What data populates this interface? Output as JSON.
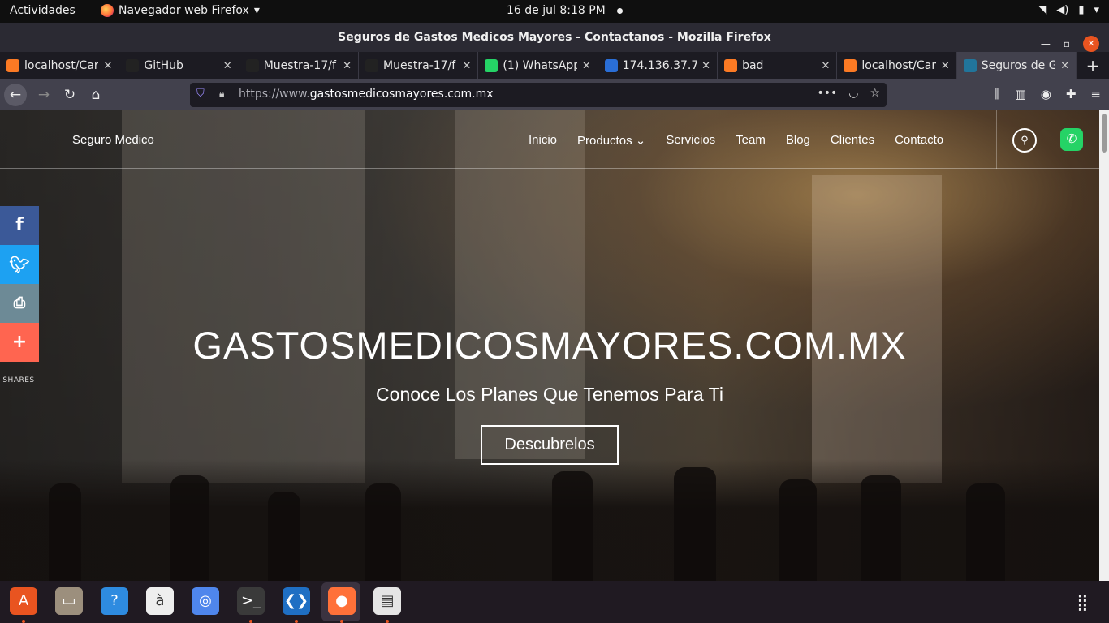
{
  "topbar": {
    "activities": "Actividades",
    "app_name": "Navegador web Firefox",
    "clock": "16 de jul   8:18 PM"
  },
  "window": {
    "title": "Seguros de Gastos Medicos Mayores - Contactanos - Mozilla Firefox"
  },
  "tabs": [
    {
      "label": "localhost/Car",
      "favicon": "xampp-icon",
      "color": "#fb7a24"
    },
    {
      "label": "GitHub",
      "favicon": "github-icon",
      "color": "#222222"
    },
    {
      "label": "Muestra-17/f",
      "favicon": "github-icon",
      "color": "#222222"
    },
    {
      "label": "Muestra-17/f",
      "favicon": "github-icon",
      "color": "#222222"
    },
    {
      "label": "(1) WhatsApp",
      "favicon": "whatsapp-icon",
      "color": "#25d366"
    },
    {
      "label": "174.136.37.7",
      "favicon": "globe-icon",
      "color": "#2a6ed6"
    },
    {
      "label": "bad",
      "favicon": "xampp-icon",
      "color": "#fb7a24"
    },
    {
      "label": "localhost/Car",
      "favicon": "xampp-icon",
      "color": "#fb7a24"
    },
    {
      "label": "Seguros de G",
      "favicon": "wordpress-icon",
      "color": "#21759b",
      "active": true
    }
  ],
  "urlbar": {
    "scheme": "https://www.",
    "host": "gastosmedicosmayores.com.mx"
  },
  "site": {
    "brand": "Seguro Medico",
    "menu": [
      "Inicio",
      "Productos ⌄",
      "Servicios",
      "Team",
      "Blog",
      "Clientes",
      "Contacto"
    ],
    "hero_title": "GASTOSMEDICOSMAYORES.COM.MX",
    "hero_subtitle": "Conoce Los Planes Que Tenemos Para Ti",
    "cta": "Descubrelos",
    "shares_label": "SHARES",
    "share_colors": {
      "facebook": "#3b5998",
      "twitter": "#1da1f2",
      "print": "#6d8a96",
      "more": "#ff6550"
    }
  },
  "dock": [
    {
      "name": "ubuntu-software-icon",
      "glyph": "A",
      "color": "#e95420",
      "running": true
    },
    {
      "name": "files-icon",
      "glyph": "▭",
      "color": "#9c8f7d",
      "running": false
    },
    {
      "name": "help-icon",
      "glyph": "?",
      "color": "#2e8be0",
      "running": false
    },
    {
      "name": "text-editor-icon",
      "glyph": "à",
      "color": "#eeeeee",
      "running": false
    },
    {
      "name": "chromium-icon",
      "glyph": "◎",
      "color": "#4f86ec",
      "running": false
    },
    {
      "name": "terminal-icon",
      "glyph": ">_",
      "color": "#3a3a3a",
      "running": true
    },
    {
      "name": "vscode-icon",
      "glyph": "❮❯",
      "color": "#1f6fc3",
      "running": true
    },
    {
      "name": "firefox-icon",
      "glyph": "●",
      "color": "#ff7139",
      "running": true
    },
    {
      "name": "screenshot-icon",
      "glyph": "▤",
      "color": "#e5e5e5",
      "running": true
    }
  ]
}
